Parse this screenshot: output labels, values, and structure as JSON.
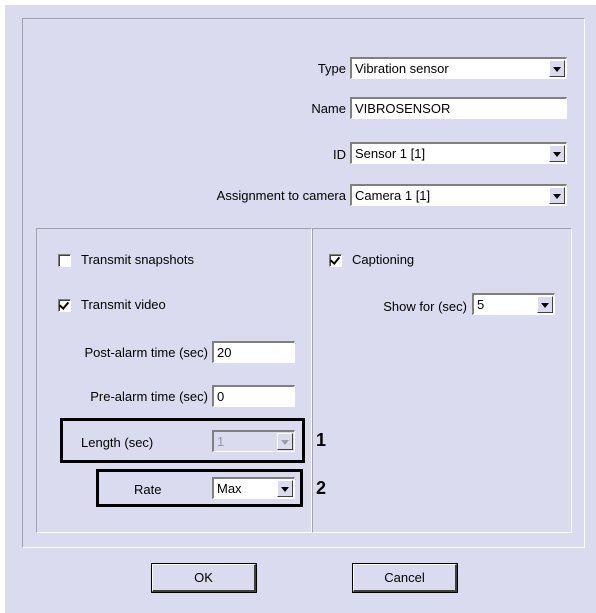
{
  "sensor": {
    "type_label": "Type",
    "type_value": "Vibration sensor",
    "name_label": "Name",
    "name_value": "VIBROSENSOR",
    "id_label": "ID",
    "id_value": "Sensor 1 [1]",
    "camera_label": "Assignment to camera",
    "camera_value": "Camera 1 [1]"
  },
  "left_panel": {
    "transmit_snapshots_label": "Transmit snapshots",
    "transmit_snapshots_checked": false,
    "transmit_video_label": "Transmit video",
    "transmit_video_checked": true,
    "post_alarm_label": "Post-alarm time (sec)",
    "post_alarm_value": "20",
    "pre_alarm_label": "Pre-alarm time (sec)",
    "pre_alarm_value": "0",
    "length_label": "Length (sec)",
    "length_value": "1",
    "rate_label": "Rate",
    "rate_value": "Max"
  },
  "right_panel": {
    "captioning_label": "Captioning",
    "captioning_checked": true,
    "show_for_label": "Show for (sec)",
    "show_for_value": "5"
  },
  "callouts": {
    "one": "1",
    "two": "2"
  },
  "buttons": {
    "ok": "OK",
    "cancel": "Cancel"
  }
}
